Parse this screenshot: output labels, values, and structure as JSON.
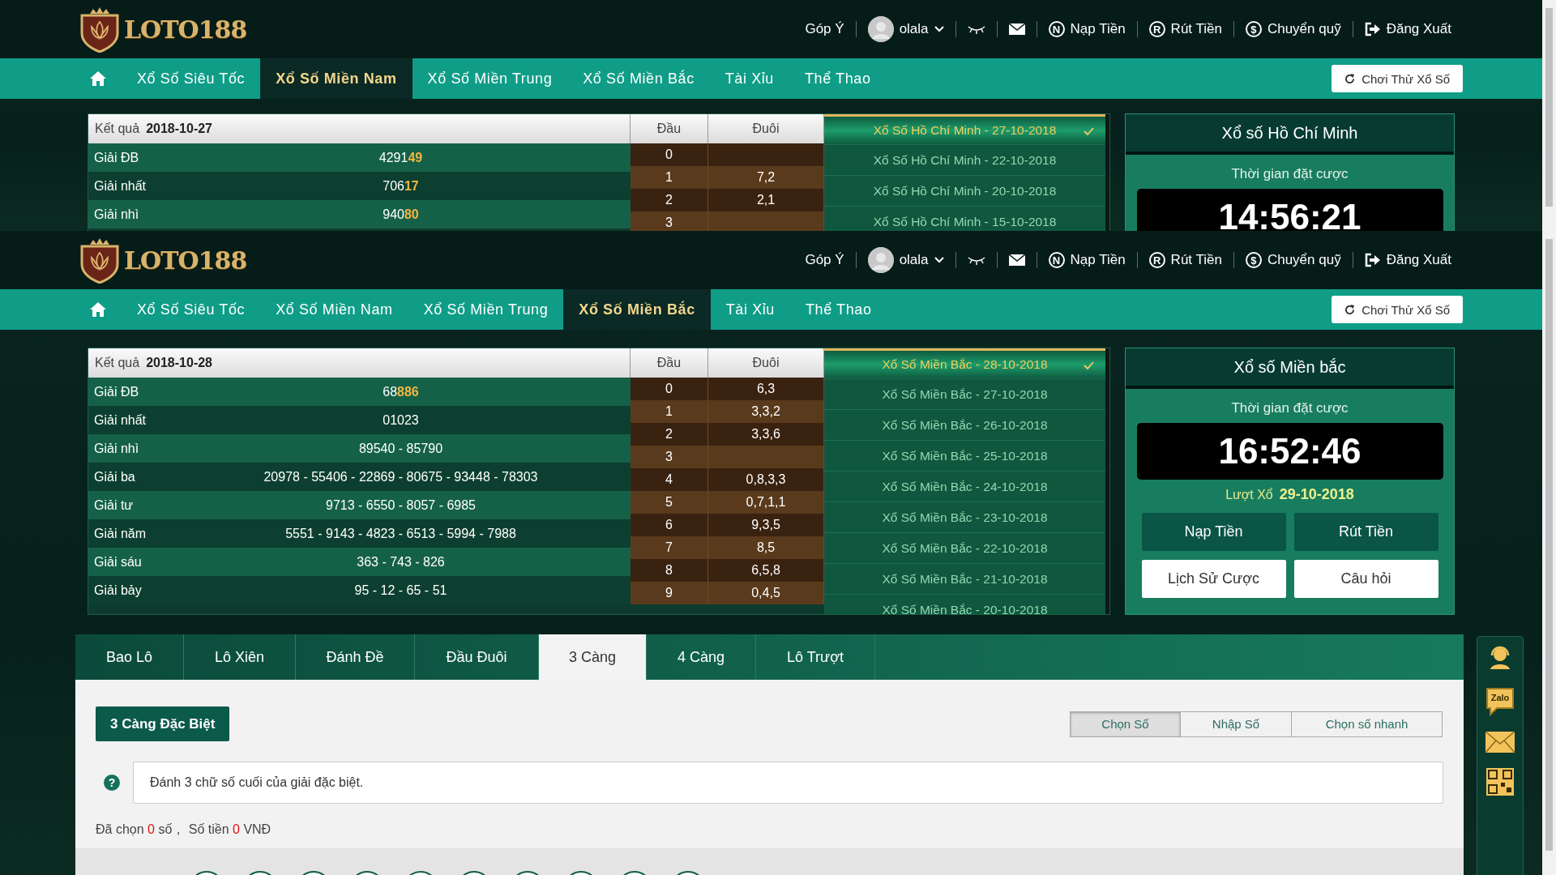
{
  "captures": [
    {
      "header": {
        "logo": "LOTO188",
        "feedback": "Góp Ý",
        "user": "olala",
        "links": [
          {
            "label": "Nạp Tiền",
            "kind": "letter",
            "icon_letter": "N"
          },
          {
            "label": "Rút Tiền",
            "kind": "letter",
            "icon_letter": "R"
          },
          {
            "label": "Chuyển quỹ",
            "kind": "letter",
            "icon_letter": "$"
          },
          {
            "label": "Đăng Xuất",
            "kind": "logout"
          }
        ]
      },
      "nav": {
        "items": [
          {
            "label": "Xổ Số Siêu Tốc",
            "selected": false
          },
          {
            "label": "Xổ Số Miền Nam",
            "selected": true
          },
          {
            "label": "Xổ Số Miền Trung",
            "selected": false
          },
          {
            "label": "Xổ Số Miền Bắc",
            "selected": false
          },
          {
            "label": "Tài Xỉu",
            "selected": false
          },
          {
            "label": "Thể Thao",
            "selected": false
          }
        ],
        "trial_button": "Chơi Thử Xổ Số"
      },
      "results": {
        "label": "Kết quả",
        "date": "2018-10-27",
        "head_title": "Đầu",
        "tail_title": "Đuôi",
        "prizes": [
          {
            "label": "Giải ĐB",
            "number": "4291",
            "highlight": "49"
          },
          {
            "label": "Giải nhất",
            "number": "706",
            "highlight": "17"
          },
          {
            "label": "Giải nhì",
            "number": "940",
            "highlight": "80"
          }
        ],
        "heads": [
          {
            "head": "0"
          },
          {
            "head": "1",
            "tail": "7,2"
          },
          {
            "head": "2",
            "tail": "2,1"
          },
          {
            "head": "3"
          }
        ],
        "draws": [
          {
            "label": "Xổ Số Hồ Chí Minh - 27-10-2018",
            "selected": true
          },
          {
            "label": "Xổ Số Hồ Chí Minh - 22-10-2018",
            "selected": false
          },
          {
            "label": "Xổ Số Hồ Chí Minh - 20-10-2018",
            "selected": false
          },
          {
            "label": "Xổ Số Hồ Chí Minh - 15-10-2018",
            "selected": false
          }
        ]
      },
      "draw_panel": {
        "title": "Xổ số Hồ Chí Minh",
        "countdown_label": "Thời gian đặt cược",
        "countdown": "14:56:21"
      }
    },
    {
      "header": {
        "logo": "LOTO188",
        "feedback": "Góp Ý",
        "user": "olala",
        "links": [
          {
            "label": "Nạp Tiền",
            "kind": "letter",
            "icon_letter": "N"
          },
          {
            "label": "Rút Tiền",
            "kind": "letter",
            "icon_letter": "R"
          },
          {
            "label": "Chuyển quỹ",
            "kind": "letter",
            "icon_letter": "$"
          },
          {
            "label": "Đăng Xuất",
            "kind": "logout"
          }
        ]
      },
      "nav": {
        "items": [
          {
            "label": "Xổ Số Siêu Tốc",
            "selected": false
          },
          {
            "label": "Xổ Số Miền Nam",
            "selected": false
          },
          {
            "label": "Xổ Số Miền Trung",
            "selected": false
          },
          {
            "label": "Xổ Số Miền Bắc",
            "selected": true
          },
          {
            "label": "Tài Xỉu",
            "selected": false
          },
          {
            "label": "Thể Thao",
            "selected": false
          }
        ],
        "trial_button": "Chơi Thử Xổ Số"
      },
      "results": {
        "label": "Kết quả",
        "date": "2018-10-28",
        "head_title": "Đầu",
        "tail_title": "Đuôi",
        "prizes": [
          {
            "label": "Giải ĐB",
            "number": "68",
            "highlight": "886"
          },
          {
            "label": "Giải nhất",
            "number": "01023"
          },
          {
            "label": "Giải nhì",
            "number": "89540 - 85790"
          },
          {
            "label": "Giải ba",
            "number": "20978 - 55406 - 22869 - 80675 - 93448 - 78303"
          },
          {
            "label": "Giải tư",
            "number": "9713 - 6550 - 8057 - 6985"
          },
          {
            "label": "Giải năm",
            "number": "5551 - 9143 - 4823 - 6513 - 5994 - 7988"
          },
          {
            "label": "Giải sáu",
            "number": "363 - 743 - 826"
          },
          {
            "label": "Giải bảy",
            "number": "95 - 12 - 65 - 51"
          }
        ],
        "heads": [
          {
            "head": "0",
            "tail": "6,3"
          },
          {
            "head": "1",
            "tail": "3,3,2"
          },
          {
            "head": "2",
            "tail": "3,3,6"
          },
          {
            "head": "3"
          },
          {
            "head": "4",
            "tail": "0,8,3,3"
          },
          {
            "head": "5",
            "tail": "0,7,1,1"
          },
          {
            "head": "6",
            "tail": "9,3,5"
          },
          {
            "head": "7",
            "tail": "8,5"
          },
          {
            "head": "8",
            "tail": "6,5,8"
          },
          {
            "head": "9",
            "tail": "0,4,5"
          }
        ],
        "draws": [
          {
            "label": "Xổ Số Miền Bắc - 28-10-2018",
            "selected": true
          },
          {
            "label": "Xổ Số Miền Bắc - 27-10-2018",
            "selected": false
          },
          {
            "label": "Xổ Số Miền Bắc - 26-10-2018",
            "selected": false
          },
          {
            "label": "Xổ Số Miền Bắc - 25-10-2018",
            "selected": false
          },
          {
            "label": "Xổ Số Miền Bắc - 24-10-2018",
            "selected": false
          },
          {
            "label": "Xổ Số Miền Bắc - 23-10-2018",
            "selected": false
          },
          {
            "label": "Xổ Số Miền Bắc - 22-10-2018",
            "selected": false
          },
          {
            "label": "Xổ Số Miền Bắc - 21-10-2018",
            "selected": false
          },
          {
            "label": "Xổ Số Miền Bắc - 20-10-2018",
            "selected": false
          }
        ]
      },
      "draw_panel": {
        "title": "Xổ số Miền bắc",
        "countdown_label": "Thời gian đặt cược",
        "countdown": "16:52:46",
        "round_label": "Lượt Xổ",
        "round_date": "29-10-2018",
        "buttons": [
          {
            "label": "Nạp Tiền",
            "kind": "dark"
          },
          {
            "label": "Rút Tiền",
            "kind": "dark"
          },
          {
            "label": "Lịch Sử Cược",
            "kind": "light"
          },
          {
            "label": "Câu hỏi",
            "kind": "light"
          }
        ]
      },
      "betting": {
        "tabs": [
          {
            "label": "Bao Lô",
            "selected": false
          },
          {
            "label": "Lô Xiên",
            "selected": false
          },
          {
            "label": "Đánh Đề",
            "selected": false
          },
          {
            "label": "Đầu Đuôi",
            "selected": false
          },
          {
            "label": "3 Càng",
            "selected": true
          },
          {
            "label": "4 Càng",
            "selected": false
          },
          {
            "label": "Lô Trượt",
            "selected": false
          }
        ],
        "type_button": "3 Càng Đặc Biệt",
        "modes": [
          {
            "label": "Chọn Số",
            "selected": true
          },
          {
            "label": "Nhập Số",
            "selected": false
          },
          {
            "label": "Chọn số nhanh",
            "selected": false
          }
        ],
        "help_mark": "?",
        "hint": "Đánh 3 chữ số cuối của giải đặc biệt.",
        "summary": {
          "picked_label": "Đã chọn",
          "picked": "0",
          "picked_unit": "số，",
          "amount_label": "Số tiền",
          "amount": "0",
          "currency": "VNĐ"
        }
      },
      "float_bar": [
        {
          "kind": "support"
        },
        {
          "kind": "zalo",
          "label": "Zalo"
        },
        {
          "kind": "mail"
        },
        {
          "kind": "qr"
        }
      ]
    }
  ]
}
